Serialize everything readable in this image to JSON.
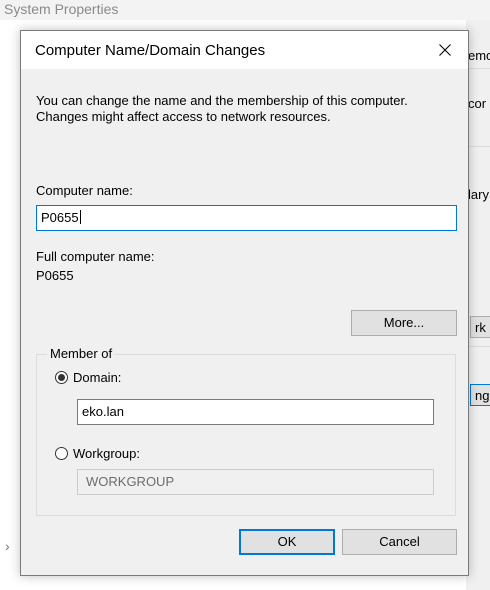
{
  "parent": {
    "title": "System Properties",
    "fragments": [
      "emo",
      "cor",
      "lary",
      "rk",
      "nge"
    ]
  },
  "dialog": {
    "title": "Computer Name/Domain Changes",
    "description": "You can change the name and the membership of this computer. Changes might affect access to network resources.",
    "computer_name_label": "Computer name:",
    "computer_name_value": "P0655",
    "full_name_label": "Full computer name:",
    "full_name_value": "P0655",
    "more_button": "More...",
    "member_of": {
      "legend": "Member of",
      "domain_label": "Domain:",
      "domain_value": "eko.lan",
      "domain_selected": true,
      "workgroup_label": "Workgroup:",
      "workgroup_value": "WORKGROUP",
      "workgroup_selected": false
    },
    "ok_button": "OK",
    "cancel_button": "Cancel"
  },
  "colors": {
    "accent": "#0078d7",
    "dialog_bg": "#f0f0f0",
    "border": "#7a7a7a"
  }
}
